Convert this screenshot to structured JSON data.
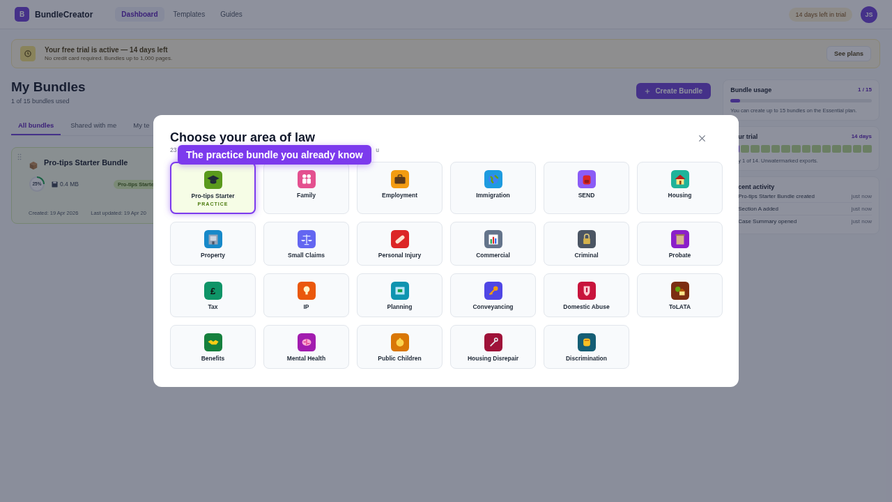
{
  "header": {
    "logo_letter": "B",
    "brand": "BundleCreator",
    "nav": [
      {
        "label": "Dashboard",
        "selected": true
      },
      {
        "label": "Templates",
        "selected": false
      },
      {
        "label": "Guides",
        "selected": false
      }
    ],
    "trial_badge": "14 days left in trial",
    "avatar": "JS"
  },
  "banner": {
    "title": "Your free trial is active — 14 days left",
    "subtitle": "No credit card required. Bundles up to 1,000 pages.",
    "button": "See plans"
  },
  "page": {
    "title": "My Bundles",
    "subtitle": "1 of 15 bundles used",
    "create_button": "Create Bundle"
  },
  "tabs": [
    {
      "label": "All bundles",
      "selected": true
    },
    {
      "label": "Shared with me",
      "selected": false
    },
    {
      "label": "My te",
      "selected": false
    }
  ],
  "bundle_card": {
    "title": "Pro-tips Starter Bundle",
    "progress": {
      "level": 0.25,
      "reading": "25%"
    },
    "size": "0.4 MB",
    "tag": "Pro-tips Starte",
    "created": "Created: 19 Apr 2026",
    "updated": "Last updated: 19 Apr 20"
  },
  "sidebar": {
    "usage": {
      "title": "Bundle usage",
      "count": "1 / 15",
      "level": 0.067,
      "note": "You can create up to 15 bundles on the Essential plan."
    },
    "trial": {
      "title": "ur trial",
      "days": "14 days",
      "level": 0.0714,
      "note": "y 1 of 14. Unwatermarked exports."
    },
    "activity": {
      "title": "cent activity",
      "items": [
        {
          "text": "Pro-tips Starter Bundle created",
          "time": "just now"
        },
        {
          "text": "Section A added",
          "time": "just now"
        },
        {
          "text": "Case Summary opened",
          "time": "just now"
        }
      ]
    }
  },
  "modal": {
    "title": "Choose your area of law",
    "subtitle_start": "23",
    "subtitle_end": "u",
    "tooltip": "The practice bundle you already know",
    "areas": [
      {
        "label": "Pro-tips Starter",
        "tag": "PRACTICE",
        "selected": true,
        "color": "#5a9a1c"
      },
      {
        "label": "Family",
        "selected": false,
        "color": "#e4508f"
      },
      {
        "label": "Employment",
        "selected": false,
        "color": "#f39c12"
      },
      {
        "label": "Immigration",
        "selected": false,
        "color": "#1e9be0"
      },
      {
        "label": "SEND",
        "selected": false,
        "color": "#8b5cf6"
      },
      {
        "label": "Housing",
        "selected": false,
        "color": "#1fb39a"
      },
      {
        "label": "Property",
        "selected": false,
        "color": "#1789c9"
      },
      {
        "label": "Small Claims",
        "selected": false,
        "color": "#6366f1"
      },
      {
        "label": "Personal Injury",
        "selected": false,
        "color": "#dc2626"
      },
      {
        "label": "Commercial",
        "selected": false,
        "color": "#64748b"
      },
      {
        "label": "Criminal",
        "selected": false,
        "color": "#4b5563"
      },
      {
        "label": "Probate",
        "selected": false,
        "color": "#8b1fc9"
      },
      {
        "label": "Tax",
        "symbol": "£",
        "selected": false,
        "color": "#0e9467"
      },
      {
        "label": "IP",
        "selected": false,
        "color": "#ea580c"
      },
      {
        "label": "Planning",
        "selected": false,
        "color": "#0f94b0"
      },
      {
        "label": "Conveyancing",
        "selected": false,
        "color": "#4f46e5"
      },
      {
        "label": "Domestic Abuse",
        "selected": false,
        "color": "#c8143c"
      },
      {
        "label": "ToLATA",
        "selected": false,
        "color": "#7c2d12"
      },
      {
        "label": "Benefits",
        "selected": false,
        "color": "#15803d"
      },
      {
        "label": "Mental Health",
        "selected": false,
        "color": "#a21caf"
      },
      {
        "label": "Public Children",
        "selected": false,
        "color": "#d97706"
      },
      {
        "label": "Housing Disrepair",
        "selected": false,
        "color": "#9f1239"
      },
      {
        "label": "Discrimination",
        "selected": false,
        "color": "#155e75"
      }
    ]
  }
}
